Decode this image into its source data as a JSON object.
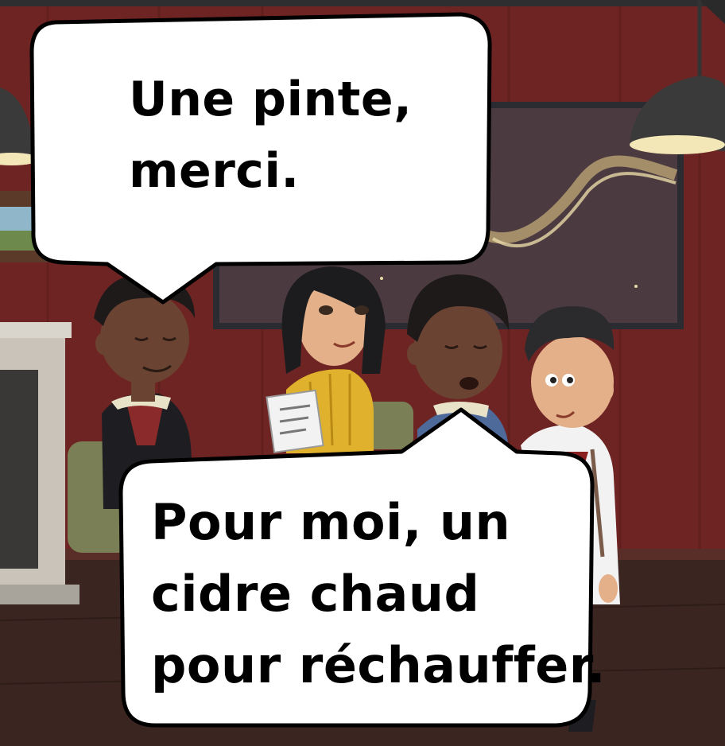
{
  "scene": {
    "bubbles": [
      {
        "speaker": "left-man",
        "text": "Une pinte,\nmerci."
      },
      {
        "speaker": "center-right-man",
        "text": "Pour moi, un\ncidre chaud\npour réchauffer."
      }
    ]
  },
  "colors": {
    "wall": "#6e2422",
    "wall_dark": "#4d1816",
    "floor": "#3b2521",
    "bubble_fill": "#ffffff",
    "bubble_stroke": "#000000",
    "sweater": "#e0b12c",
    "skin_dark": "#6b4332",
    "skin_light": "#e3b08a"
  }
}
